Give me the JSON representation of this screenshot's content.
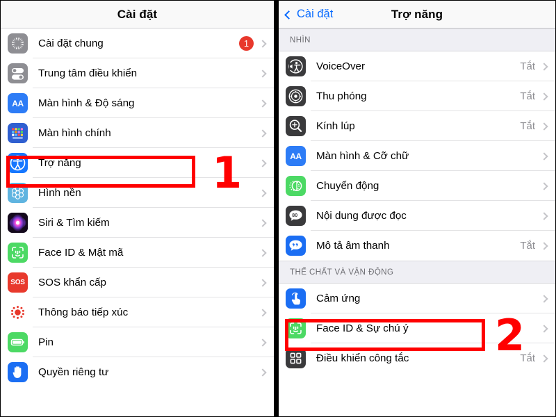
{
  "left_panel": {
    "nav": {
      "title": "Cài đặt"
    },
    "rows": [
      {
        "label": "Cài đặt chung",
        "icon": "gear-icon",
        "badge": "1",
        "value": ""
      },
      {
        "label": "Trung tâm điều khiển",
        "icon": "control-center-icon",
        "badge": "",
        "value": ""
      },
      {
        "label": "Màn hình & Độ sáng",
        "icon": "display-brightness-icon",
        "badge": "",
        "value": ""
      },
      {
        "label": "Màn hình chính",
        "icon": "home-screen-icon",
        "badge": "",
        "value": ""
      },
      {
        "label": "Trợ năng",
        "icon": "accessibility-icon",
        "badge": "",
        "value": ""
      },
      {
        "label": "Hình nền",
        "icon": "wallpaper-icon",
        "badge": "",
        "value": ""
      },
      {
        "label": "Siri & Tìm kiếm",
        "icon": "siri-icon",
        "badge": "",
        "value": ""
      },
      {
        "label": "Face ID & Mật mã",
        "icon": "face-id-icon",
        "badge": "",
        "value": ""
      },
      {
        "label": "SOS khẩn cấp",
        "icon": "sos-icon",
        "badge": "",
        "value": ""
      },
      {
        "label": "Thông báo tiếp xúc",
        "icon": "exposure-notification-icon",
        "badge": "",
        "value": ""
      },
      {
        "label": "Pin",
        "icon": "battery-icon",
        "badge": "",
        "value": ""
      },
      {
        "label": "Quyền riêng tư",
        "icon": "privacy-hand-icon",
        "badge": "",
        "value": ""
      }
    ]
  },
  "right_panel": {
    "nav": {
      "back_label": "Cài đặt",
      "title": "Trợ năng"
    },
    "sections": [
      {
        "header": "NHÌN",
        "rows": [
          {
            "label": "VoiceOver",
            "icon": "voiceover-icon",
            "value": "Tắt"
          },
          {
            "label": "Thu phóng",
            "icon": "zoom-icon",
            "value": "Tắt"
          },
          {
            "label": "Kính lúp",
            "icon": "magnifier-icon",
            "value": "Tắt"
          },
          {
            "label": "Màn hình & Cỡ chữ",
            "icon": "display-text-size-icon",
            "value": ""
          },
          {
            "label": "Chuyển động",
            "icon": "motion-icon",
            "value": ""
          },
          {
            "label": "Nội dung được đọc",
            "icon": "spoken-content-icon",
            "value": ""
          },
          {
            "label": "Mô tả âm thanh",
            "icon": "audio-description-icon",
            "value": "Tắt"
          }
        ]
      },
      {
        "header": "THỂ CHẤT VÀ VẬN ĐỘNG",
        "rows": [
          {
            "label": "Cảm ứng",
            "icon": "touch-icon",
            "value": ""
          },
          {
            "label": "Face ID & Sự chú ý",
            "icon": "face-id-icon",
            "value": ""
          },
          {
            "label": "Điều khiển công tắc",
            "icon": "switch-control-icon",
            "value": "Tắt"
          }
        ]
      }
    ]
  },
  "annotations": {
    "step_one": "1",
    "step_two": "2",
    "highlight_color": "#ff0000"
  },
  "colors": {
    "accent_blue": "#0a6cff",
    "badge_red": "#e8382c",
    "value_gray": "#8e8e93",
    "section_bg": "#efeff4"
  }
}
